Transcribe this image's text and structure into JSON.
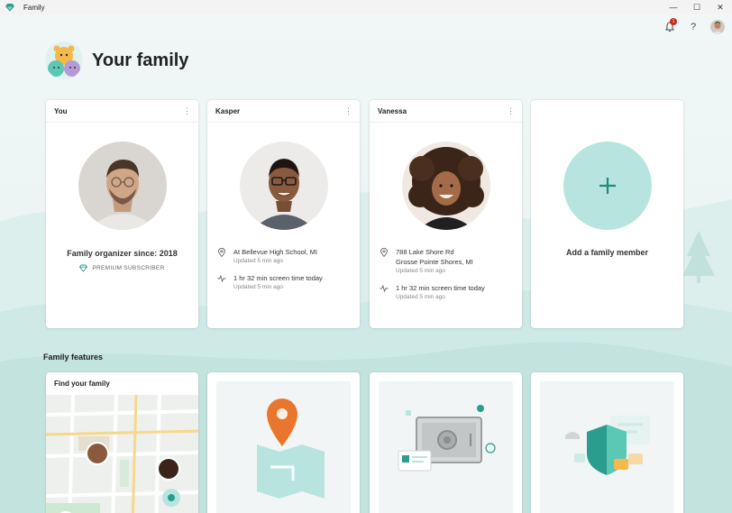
{
  "window": {
    "title": "Family",
    "controls": [
      "—",
      "☐",
      "✕"
    ]
  },
  "topbar": {
    "notification_count": "1",
    "help_label": "?"
  },
  "header": {
    "title": "Your family"
  },
  "members": [
    {
      "name": "You",
      "organizer": "Family organizer since: 2018",
      "badge": "PREMIUM SUBSCRIBER"
    },
    {
      "name": "Kasper",
      "location": "At Bellevue High School, MI",
      "location_updated": "Updated 5 min ago",
      "screen_time": "1 hr 32 min screen time today",
      "screen_updated": "Updated 5 min ago"
    },
    {
      "name": "Vanessa",
      "location_line1": "788 Lake Shore Rd",
      "location_line2": "Grosse Pointe Shores, MI",
      "location_updated": "Updated 5 min ago",
      "screen_time": "1 hr 32 min screen time today",
      "screen_updated": "Updated 5 min ago"
    }
  ],
  "add_member": {
    "label": "Add a family member"
  },
  "features": {
    "section_title": "Family features",
    "find_family": {
      "title": "Find your family"
    }
  },
  "colors": {
    "accent": "#2a9d8f",
    "accent_light": "#b8e4e0",
    "badge": "#c42b1c",
    "pin": "#e8762d"
  }
}
